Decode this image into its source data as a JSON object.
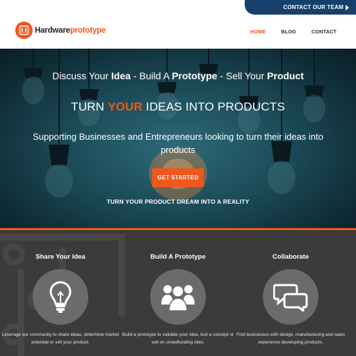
{
  "top": {
    "contact_label": "CONTACT OUR TEAM"
  },
  "logo": {
    "text_a": "Hardware",
    "text_b": "prototype"
  },
  "nav": {
    "items": [
      "HOME",
      "BLOG",
      "CONTACT"
    ],
    "active": "HOME"
  },
  "hero": {
    "line1": {
      "p1": "Discuss Your ",
      "b1": "Idea",
      "p2": " - Build A ",
      "b2": "Prototype",
      "p3": " - Sell Your ",
      "b3": "Product"
    },
    "line2": {
      "p1": "TURN ",
      "hl": "YOUR",
      "p2": " IDEAS INTO PRODUCTS"
    },
    "line3": "Supporting Businesses and Entrepreneurs looking to turn their ideas into products",
    "cta_label": "GET STARTED",
    "tagline": "TURN YOUR PRODUCT DREAM INTO A REALITY"
  },
  "features": [
    {
      "title": "Share Your Idea",
      "icon": "lightbulb-icon",
      "desc": "Leverage our community to share ideas, determine market potential or sell your product."
    },
    {
      "title": "Build A Prototype",
      "icon": "people-icon",
      "desc": "Build a prototype to validate your idea, test a concept or sell on crowdfunding sites."
    },
    {
      "title": "Collaborate",
      "icon": "chat-bubbles-icon",
      "desc": "Find businesses with design, manufacturing and sales experience developing products."
    }
  ],
  "colors": {
    "accent": "#f0571c",
    "navy": "#173f6b",
    "dark": "#3b3b3b",
    "icon_circle": "#6b6b6b"
  }
}
